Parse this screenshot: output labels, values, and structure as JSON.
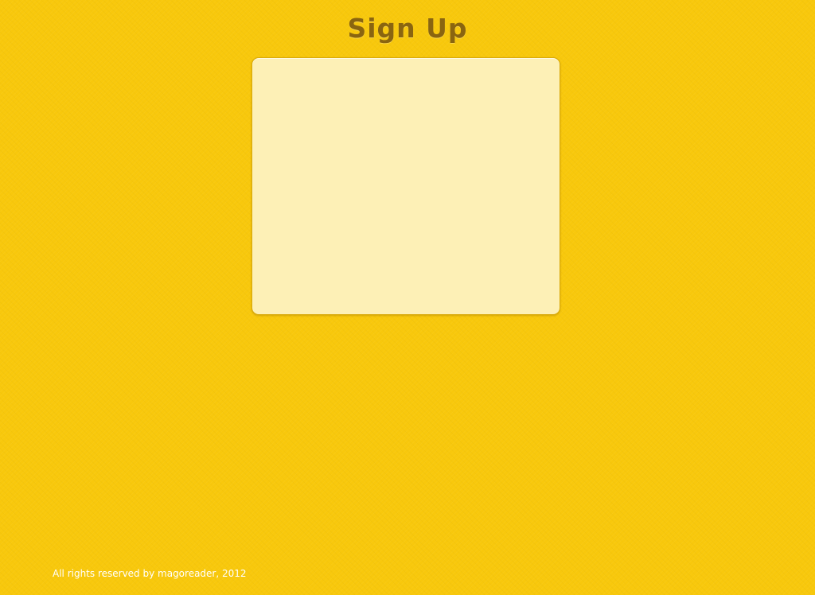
{
  "header": {
    "title": "Sign Up"
  },
  "signup_panel": {},
  "footer": {
    "copyright": "All rights reserved by magoreader, 2012"
  },
  "colors": {
    "background": "#f8c80c",
    "panel": "#fdf0b6",
    "title": "#8a6510",
    "footer_text": "#ffffff"
  }
}
